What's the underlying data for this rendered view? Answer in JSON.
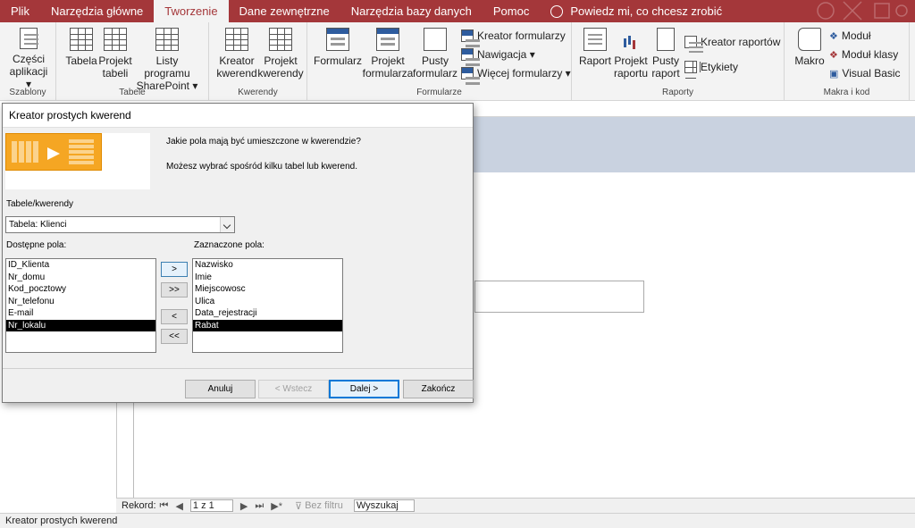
{
  "ribbon_tabs": [
    {
      "label": "Plik",
      "active": false
    },
    {
      "label": "Narzędzia główne",
      "active": false
    },
    {
      "label": "Tworzenie",
      "active": true
    },
    {
      "label": "Dane zewnętrzne",
      "active": false
    },
    {
      "label": "Narzędzia bazy danych",
      "active": false
    },
    {
      "label": "Pomoc",
      "active": false
    }
  ],
  "tell_me": "Powiedz mi, co chcesz zrobić",
  "groups": {
    "szablony": {
      "label": "Szablony",
      "czesci_line1": "Części",
      "czesci_line2": "aplikacji ▾"
    },
    "tabele": {
      "label": "Tabele",
      "tabela": "Tabela",
      "projekt_line1": "Projekt",
      "projekt_line2": "tabeli",
      "listy_line1": "Listy programu",
      "listy_line2": "SharePoint ▾"
    },
    "kwerendy": {
      "label": "Kwerendy",
      "kreator_line1": "Kreator",
      "kreator_line2": "kwerend",
      "projekt_line1": "Projekt",
      "projekt_line2": "kwerendy"
    },
    "formularze": {
      "label": "Formularze",
      "formularz": "Formularz",
      "projekt_line1": "Projekt",
      "projekt_line2": "formularza",
      "pusty_line1": "Pusty",
      "pusty_line2": "formularz",
      "kreator": "Kreator formularzy",
      "nawigacja": "Nawigacja ▾",
      "wiecej": "Więcej formularzy ▾"
    },
    "raporty": {
      "label": "Raporty",
      "raport": "Raport",
      "projekt_line1": "Projekt",
      "projekt_line2": "raportu",
      "pusty_line1": "Pusty",
      "pusty_line2": "raport",
      "kreator": "Kreator raportów",
      "etykiety": "Etykiety"
    },
    "makra": {
      "label": "Makra i kod",
      "makro": "Makro",
      "modul": "Moduł",
      "modul_klasy": "Moduł klasy",
      "vba": "Visual Basic"
    }
  },
  "dialog": {
    "title": "Kreator prostych kwerend",
    "question": "Jakie pola mają być umieszczone w kwerendzie?",
    "hint": "Możesz wybrać spośród kilku tabel lub kwerend.",
    "tables_label": "Tabele/kwerendy",
    "table_value": "Tabela: Klienci",
    "available_label": "Dostępne pola:",
    "selected_label": "Zaznaczone pola:",
    "available_fields": [
      "ID_Klienta",
      "Nr_domu",
      "Kod_pocztowy",
      "Nr_telefonu",
      "E-mail",
      "Nr_lokalu"
    ],
    "available_selected_index": 5,
    "selected_fields": [
      "Nazwisko",
      "Imie",
      "Miejscowosc",
      "Ulica",
      "Data_rejestracji",
      "Rabat"
    ],
    "selected_selected_index": 5,
    "btn_add": ">",
    "btn_add_all": ">>",
    "btn_remove": "<",
    "btn_remove_all": "<<",
    "btn_cancel": "Anuluj",
    "btn_back": "< Wstecz",
    "btn_next": "Dalej >",
    "btn_finish": "Zakończ"
  },
  "nav": {
    "record_label": "Rekord:",
    "record_value": "1 z 1",
    "filter": "Bez filtru",
    "search": "Wyszukaj"
  },
  "status": "Kreator prostych kwerend",
  "colors": {
    "accent": "#a4373a",
    "ribbon": "#f3f3f3",
    "selection": "#000000"
  }
}
